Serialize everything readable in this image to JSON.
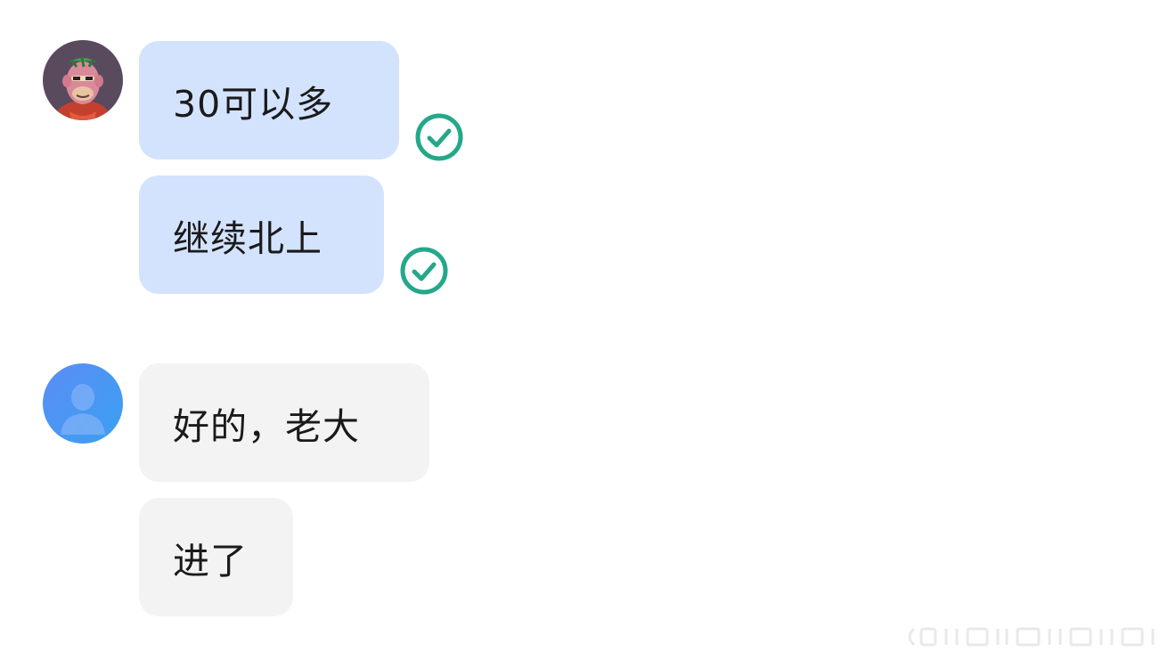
{
  "conversation": {
    "self": {
      "avatar_icon": "bored-ape-avatar-icon",
      "messages": [
        {
          "text": "30可以多",
          "status": "read-check-icon"
        },
        {
          "text": "继续北上",
          "status": "read-check-icon"
        }
      ]
    },
    "other": {
      "avatar_icon": "default-user-avatar-icon",
      "messages": [
        {
          "text": "好的，老大"
        },
        {
          "text": "进了"
        }
      ]
    }
  },
  "colors": {
    "self_bubble": "#d3e3fd",
    "other_bubble": "#f3f3f3",
    "check_green": "#24a88a",
    "default_avatar_blue": "#4a8af4",
    "text": "#1a1a1a"
  }
}
